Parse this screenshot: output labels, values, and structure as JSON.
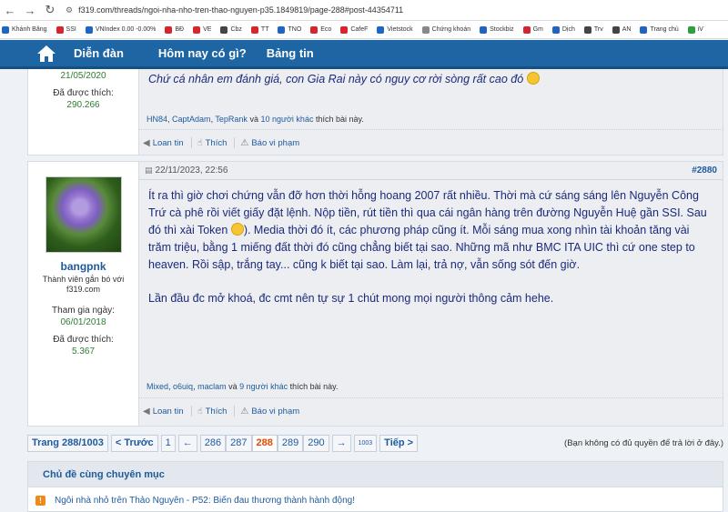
{
  "browser": {
    "url": "f319.com/threads/ngoi-nha-nho-tren-thao-nguyen-p35.1849819/page-288#post-44354711",
    "bookmarks": [
      {
        "label": "Khánh Băng",
        "color": "#1e65c8"
      },
      {
        "label": "SSI",
        "color": "#d9232e"
      },
      {
        "label": "VNIndex 0.00 -0.00%",
        "color": "#1e65c8"
      },
      {
        "label": "BĐ",
        "color": "#d9232e"
      },
      {
        "label": "VE",
        "color": "#d9232e"
      },
      {
        "label": "Cbz",
        "color": "#444444"
      },
      {
        "label": "TT",
        "color": "#d9232e"
      },
      {
        "label": "TNO",
        "color": "#1e65c8"
      },
      {
        "label": "Eco",
        "color": "#d9232e"
      },
      {
        "label": "CafeF",
        "color": "#d9232e"
      },
      {
        "label": "Vietstock",
        "color": "#1e65c8"
      },
      {
        "label": "Chứng khoán",
        "color": "#888888"
      },
      {
        "label": "Stockbiz",
        "color": "#1e65c8"
      },
      {
        "label": "Gm",
        "color": "#d9232e"
      },
      {
        "label": "Dịch",
        "color": "#1e65c8"
      },
      {
        "label": "Trv",
        "color": "#444444"
      },
      {
        "label": "AN",
        "color": "#444444"
      },
      {
        "label": "Trang chủ",
        "color": "#1e65c8"
      },
      {
        "label": "iV",
        "color": "#2e9e3e"
      }
    ]
  },
  "nav": {
    "items": [
      "Diễn đàn",
      "Hôm nay có gì?",
      "Bảng tin"
    ]
  },
  "post1": {
    "user_join_date": "21/05/2020",
    "likes_label": "Đã được thích:",
    "likes_value": "290.266",
    "text": "Chứ cá nhân em đánh giá, con Gia Rai này có nguy cơ rời sòng rất cao đó",
    "likers": [
      "HN84",
      "CaptAdam",
      "TepRank"
    ],
    "likers_and": "và",
    "likers_others": "10 người khác",
    "likers_suffix": "thích bài này."
  },
  "post2": {
    "date": "22/11/2023, 22:56",
    "number": "#2880",
    "username": "bangpnk",
    "user_title": "Thành viên gắn bó với f319.com",
    "join_label": "Tham gia ngày:",
    "join_value": "06/01/2018",
    "likes_label": "Đã được thích:",
    "likes_value": "5.367",
    "para1_a": "Ít ra thì giờ chơi chứng vẫn đỡ hơn thời hỗng hoang 2007 rất nhiều. Thời mà cứ sáng sáng lên Nguyễn Công Trứ cà phê rồi viết giấy đặt lệnh. Nộp tiền, rút tiền thì qua cái ngân hàng trên đường Nguyễn Huệ gần SSI. Sau đó thì xài Token",
    "para1_b": "). Media thời đó ít, các phương pháp cũng ít. Mỗi sáng mua xong nhìn tài khoản tăng vài trăm triệu, bằng 1 miếng đất thời đó cũng chẳng biết tại sao. Những mã như BMC ITA UIC thì cứ one step to heaven. Rồi sập, trắng tay... cũng k biết tại sao. Làm lại, trả nợ, vẫn sống sót đến giờ.",
    "para2": "Lần đầu đc mở khoá, đc cmt nên tự sự 1 chút mong mọi người thông cảm hehe.",
    "likers": [
      "Mixed",
      "o6uiq",
      "maclam"
    ],
    "likers_and": "và",
    "likers_others": "9 người khác",
    "likers_suffix": "thích bài này."
  },
  "actions": {
    "share": "Loan tin",
    "like": "Thích",
    "report": "Báo vi phạm"
  },
  "pagination": {
    "page_info": "Trang 288/1003",
    "prev": "< Trước",
    "first": "1",
    "back_arrow": "←",
    "pages": [
      "286",
      "287",
      "288",
      "289",
      "290"
    ],
    "current": "288",
    "fwd_arrow": "→",
    "last": "1003",
    "next": "Tiếp >",
    "no_permission": "(Bạn không có đủ quyền để trả lời ở đây.)"
  },
  "related": {
    "title": "Chủ đề cùng chuyên mục",
    "items": [
      {
        "badge": "!",
        "title": "Ngôi nhà nhỏ trên Thảo Nguyên - P52: Biến đau thương thành hành động!"
      }
    ]
  }
}
